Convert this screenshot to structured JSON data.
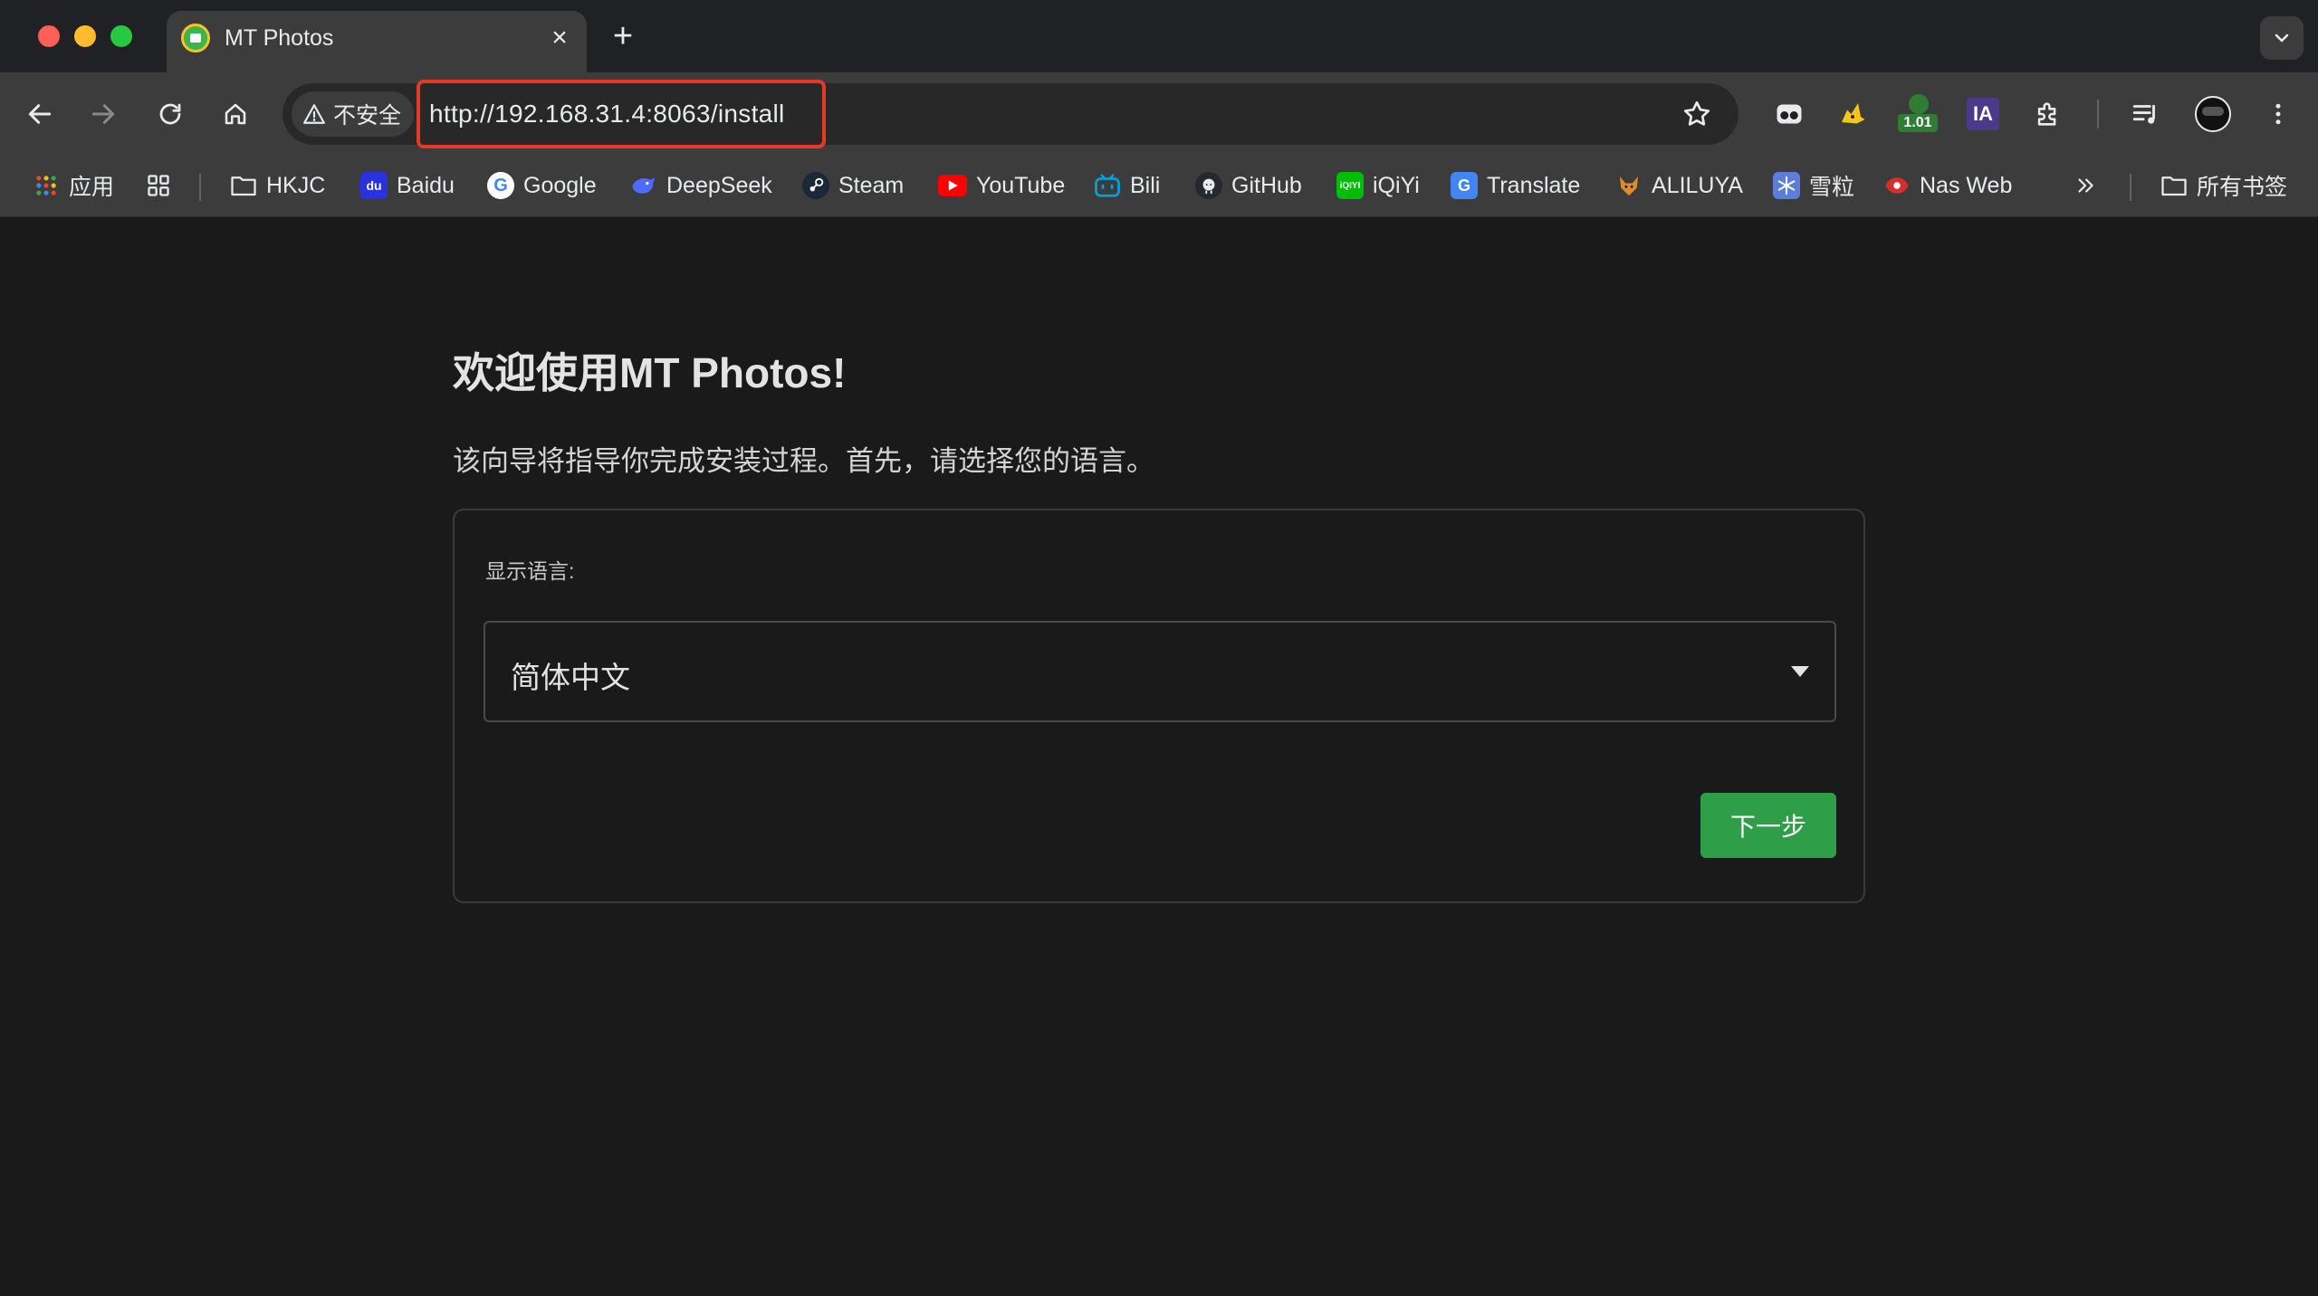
{
  "tab": {
    "title": "MT Photos"
  },
  "address_bar": {
    "security_label": "不安全",
    "url": "http://192.168.31.4:8063/install"
  },
  "extensions": {
    "badge_value": "1.01",
    "ia_label": "IA"
  },
  "bookmarks": [
    {
      "label": "应用",
      "icon": "apps-grid-icon"
    },
    {
      "label": "",
      "icon": "tab-groups-icon"
    },
    {
      "label": "HKJC",
      "icon": "folder-icon"
    },
    {
      "label": "Baidu",
      "icon": "baidu-icon"
    },
    {
      "label": "Google",
      "icon": "google-icon"
    },
    {
      "label": "DeepSeek",
      "icon": "deepseek-icon"
    },
    {
      "label": "Steam",
      "icon": "steam-icon"
    },
    {
      "label": "YouTube",
      "icon": "youtube-icon"
    },
    {
      "label": "Bili",
      "icon": "bilibili-icon"
    },
    {
      "label": "GitHub",
      "icon": "github-icon"
    },
    {
      "label": "iQiYi",
      "icon": "iqiyi-icon"
    },
    {
      "label": "Translate",
      "icon": "translate-icon"
    },
    {
      "label": "ALILUYA",
      "icon": "aliluya-icon"
    },
    {
      "label": "雪粒",
      "icon": "xueli-icon"
    },
    {
      "label": "Nas Web",
      "icon": "nas-web-icon"
    }
  ],
  "all_bookmarks_label": "所有书签",
  "installer": {
    "heading": "欢迎使用MT Photos!",
    "subtitle": "该向导将指导你完成安装过程。首先，请选择您的语言。",
    "language_label": "显示语言:",
    "language_selected": "简体中文",
    "next_button": "下一步"
  },
  "colors": {
    "accent_green": "#2e9e48",
    "url_highlight": "#e53925",
    "background": "#1a1a1a"
  }
}
